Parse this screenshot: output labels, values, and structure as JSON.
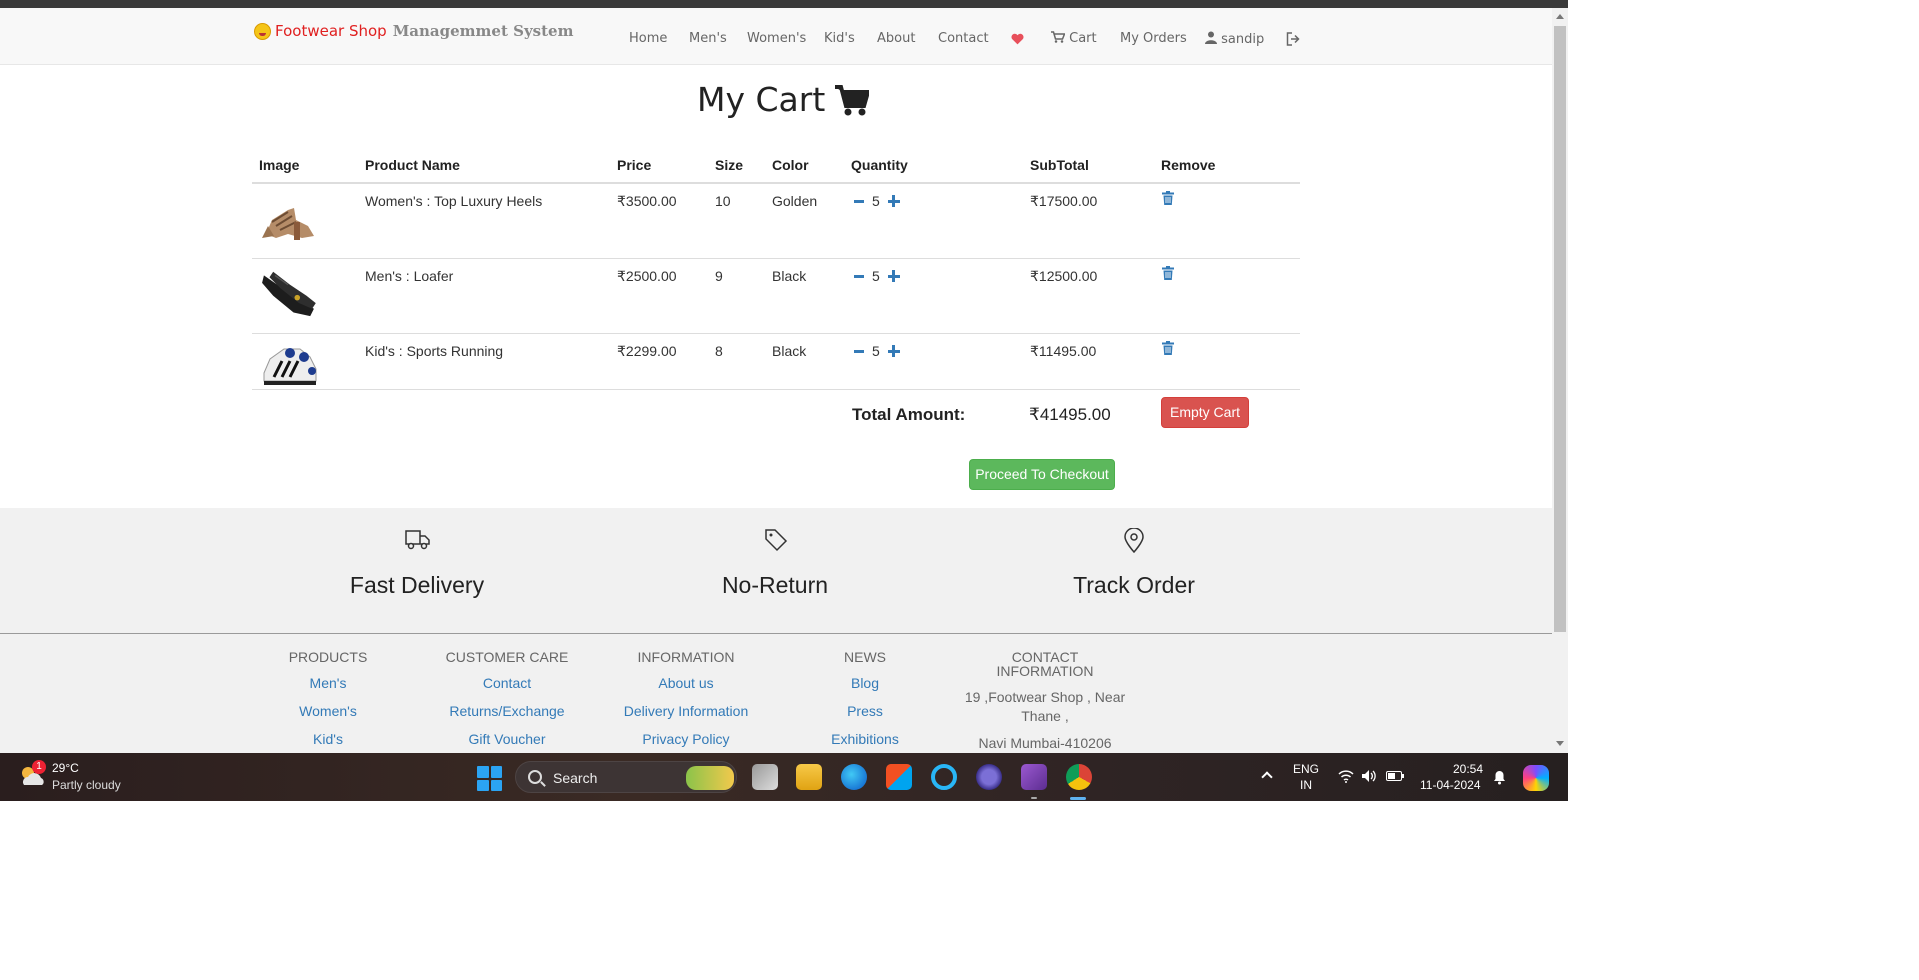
{
  "brand": {
    "part1": "Footwear Shop",
    "part2": "Managemmet System"
  },
  "nav": {
    "home": "Home",
    "mens": "Men's",
    "womens": "Women's",
    "kids": "Kid's",
    "about": "About",
    "contact": "Contact",
    "cart": "Cart",
    "orders": "My Orders",
    "user": "sandip"
  },
  "cart": {
    "title": "My Cart",
    "headers": [
      "Image",
      "Product Name",
      "Price",
      "Size",
      "Color",
      "Quantity",
      "SubTotal",
      "Remove"
    ],
    "rows": [
      {
        "name": "Women's : Top Luxury Heels",
        "price": "₹3500.00",
        "size": "10",
        "color": "Golden",
        "qty": "5",
        "subtotal": "₹17500.00"
      },
      {
        "name": "Men's : Loafer",
        "price": "₹2500.00",
        "size": "9",
        "color": "Black",
        "qty": "5",
        "subtotal": "₹12500.00"
      },
      {
        "name": "Kid's : Sports Running",
        "price": "₹2299.00",
        "size": "8",
        "color": "Black",
        "qty": "5",
        "subtotal": "₹11495.00"
      }
    ],
    "total_label": "Total Amount:",
    "total_value": "₹41495.00",
    "empty_label": "Empty Cart",
    "checkout_label": "Proceed To Checkout"
  },
  "features": {
    "delivery": "Fast Delivery",
    "no_return": "No-Return",
    "track": "Track Order"
  },
  "footer": {
    "products": {
      "title": "PRODUCTS",
      "links": [
        "Men's",
        "Women's",
        "Kid's"
      ]
    },
    "care": {
      "title": "CUSTOMER CARE",
      "links": [
        "Contact",
        "Returns/Exchange",
        "Gift Voucher"
      ]
    },
    "info": {
      "title": "INFORMATION",
      "links": [
        "About us",
        "Delivery Information",
        "Privacy Policy"
      ]
    },
    "news": {
      "title": "NEWS",
      "links": [
        "Blog",
        "Press",
        "Exhibitions"
      ]
    },
    "contact": {
      "title1": "CONTACT",
      "title2": "INFORMATION",
      "line1": "19 ,Footwear Shop , Near",
      "line2": "Thane ,",
      "line3": "Navi Mumbai-410206"
    }
  },
  "taskbar": {
    "badge": "1",
    "temp": "29°C",
    "weather": "Partly cloudy",
    "search": "Search",
    "lang1": "ENG",
    "lang2": "IN",
    "time": "20:54",
    "date": "11-04-2024"
  },
  "colors": {
    "primary_link": "#337ab7",
    "danger": "#d9534f",
    "success": "#5cb85c",
    "brand_red": "#e02020"
  }
}
